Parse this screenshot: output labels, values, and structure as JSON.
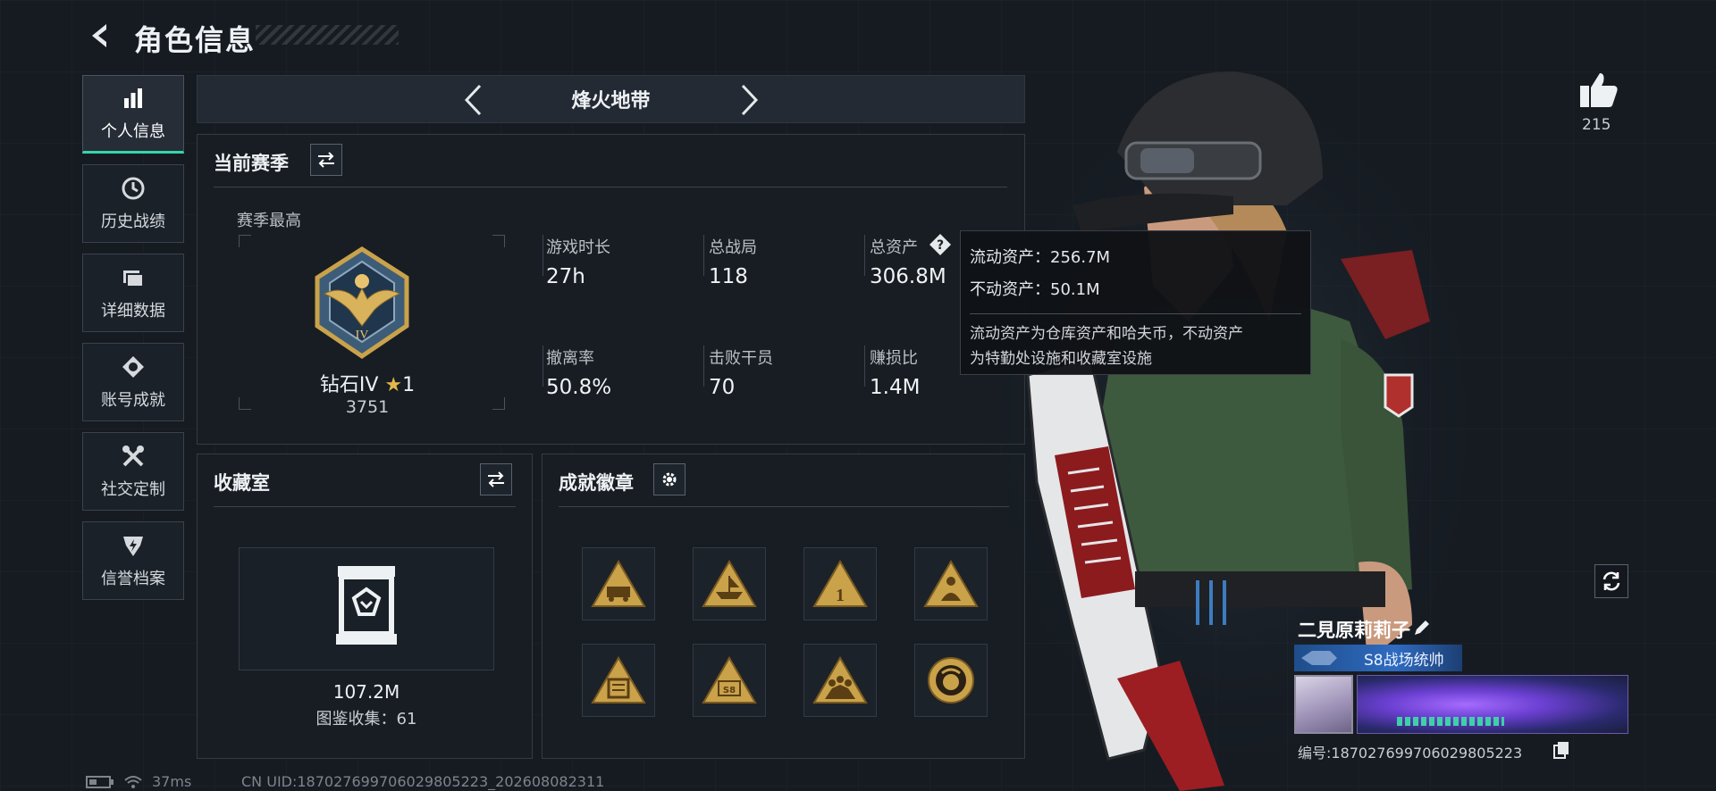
{
  "header": {
    "title": "角色信息"
  },
  "sidebar": {
    "items": [
      {
        "label": "个人信息",
        "icon": "bar-chart-icon",
        "active": true
      },
      {
        "label": "历史战绩",
        "icon": "clock-icon",
        "active": false
      },
      {
        "label": "详细数据",
        "icon": "folder-icon",
        "active": false
      },
      {
        "label": "账号成就",
        "icon": "achievement-icon",
        "active": false
      },
      {
        "label": "社交定制",
        "icon": "tools-icon",
        "active": false
      },
      {
        "label": "信誉档案",
        "icon": "shield-icon",
        "active": false
      }
    ]
  },
  "mode": {
    "title": "烽火地带"
  },
  "season": {
    "title": "当前赛季",
    "best_label": "赛季最高",
    "rank_name": "钻石IV",
    "rank_stars": "1",
    "rank_score": "3751",
    "stats": [
      {
        "label": "游戏时长",
        "value": "27h"
      },
      {
        "label": "总战局",
        "value": "118"
      },
      {
        "label": "总资产",
        "value": "306.8M"
      },
      {
        "label": "撤离率",
        "value": "50.8%"
      },
      {
        "label": "击败干员",
        "value": "70"
      },
      {
        "label": "赚损比",
        "value": "1.4M"
      }
    ]
  },
  "tooltip": {
    "liquid": "流动资产：256.7M",
    "fixed": "不动资产：50.1M",
    "desc_line1": "流动资产为仓库资产和哈夫币，不动资产",
    "desc_line2": "为特勤处设施和收藏室设施"
  },
  "collection": {
    "title": "收藏室",
    "value": "107.2M",
    "count_text": "图鉴收集：61"
  },
  "badges": {
    "title": "成就徽章",
    "items": [
      "badge-vehicle-icon",
      "badge-ship-icon",
      "badge-number-one-icon",
      "badge-soldier-icon",
      "badge-crate-icon",
      "badge-s8-icon",
      "badge-squad-icon",
      "badge-medal-icon"
    ]
  },
  "profile": {
    "likes": "215",
    "name": "二見原莉莉子",
    "title": "S8战场统帅",
    "serial": "编号:18702769970602980522​3"
  },
  "footer": {
    "ping": "37ms",
    "uid": "CN UID:18702769970602980522​3_202608082311"
  },
  "colors": {
    "accent": "#35d6a6",
    "gold": "#c9a24a",
    "panel_bg": "#181d24"
  }
}
